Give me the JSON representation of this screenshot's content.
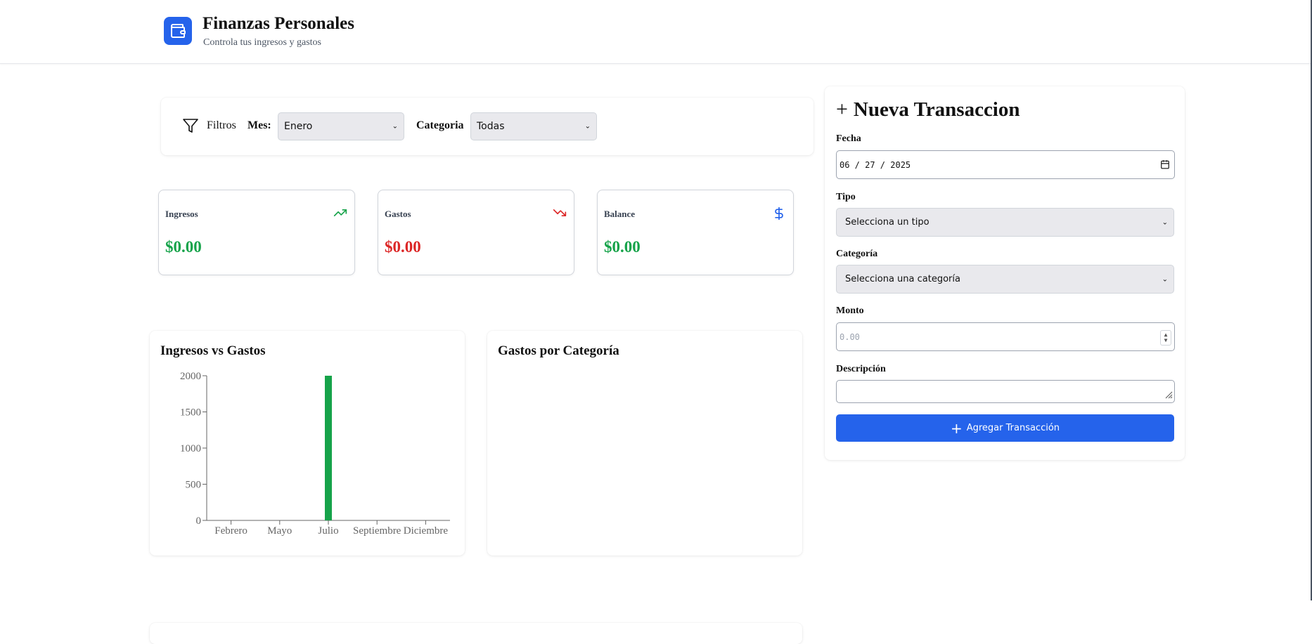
{
  "header": {
    "title": "Finanzas Personales",
    "subtitle": "Controla tus ingresos y gastos",
    "logo_icon": "wallet-icon"
  },
  "filters": {
    "label": "Filtros",
    "icon": "filter-icon",
    "month_label": "Mes:",
    "month_value": "Enero",
    "category_label": "Categoria",
    "category_value": "Todas"
  },
  "stats": [
    {
      "label": "Ingresos",
      "value": "$0.00",
      "icon": "trending-up-icon",
      "color": "#16a34a"
    },
    {
      "label": "Gastos",
      "value": "$0.00",
      "icon": "trending-down-icon",
      "color": "#dc2626"
    },
    {
      "label": "Balance",
      "value": "$0.00",
      "icon": "dollar-icon",
      "color": "#16a34a"
    }
  ],
  "charts": {
    "income_vs_expense_title": "Ingresos vs Gastos",
    "by_category_title": "Gastos por Categoría"
  },
  "chart_data": {
    "type": "bar",
    "title": "Ingresos vs Gastos",
    "categories": [
      "Febrero",
      "Mayo",
      "Julio",
      "Septiembre",
      "Diciembre"
    ],
    "series": [
      {
        "values": [
          0,
          0,
          2000,
          0,
          0
        ],
        "color": "#16a34a"
      }
    ],
    "yticks": [
      0,
      500,
      1000,
      1500,
      2000
    ],
    "ylim": [
      0,
      2000
    ]
  },
  "form": {
    "title": "Nueva Transaccion",
    "date_label": "Fecha",
    "date_value": "06 / 27 / 2025",
    "type_label": "Tipo",
    "type_value": "Selecciona un tipo",
    "category_label": "Categoría",
    "category_value": "Selecciona una categoría",
    "amount_label": "Monto",
    "amount_placeholder": "0.00",
    "description_label": "Descripción",
    "submit_label": "Agregar Transacción"
  },
  "colors": {
    "accent": "#2563eb",
    "income": "#16a34a",
    "expense": "#dc2626"
  }
}
